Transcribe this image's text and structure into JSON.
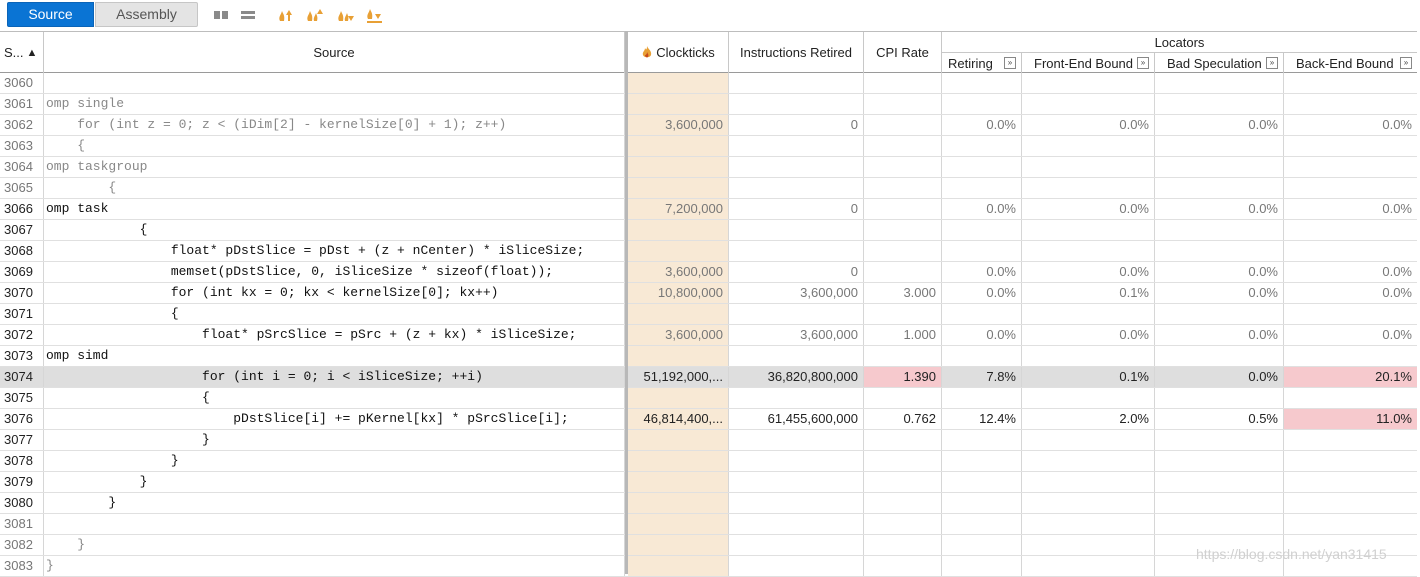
{
  "toolbar": {
    "tab_source": "Source",
    "tab_assembly": "Assembly",
    "icons": [
      "columns-icon",
      "rows-icon",
      "flame-up-icon",
      "flame-up-next-icon",
      "flame-down-icon",
      "flame-down-next-icon"
    ],
    "accent": "#0a74d4",
    "flame_color": "#e8a035"
  },
  "header": {
    "col_line": "S...",
    "col_source": "Source",
    "col_clockticks": "Clockticks",
    "col_instructions": "Instructions Retired",
    "col_cpi": "CPI Rate",
    "group_locators": "Locators",
    "sub_retiring": "Retiring",
    "sub_frontend": "Front-End Bound",
    "sub_badspec": "Bad Speculation",
    "sub_backend": "Back-End Bound",
    "expand_glyph": "»"
  },
  "rows": [
    {
      "line": "3060",
      "src": "",
      "clk": "",
      "ins": "",
      "cpi": "",
      "ret": "",
      "fe": "",
      "bs": "",
      "be": ""
    },
    {
      "line": "3061",
      "src": "omp single",
      "clk": "",
      "ins": "",
      "cpi": "",
      "ret": "",
      "fe": "",
      "bs": "",
      "be": ""
    },
    {
      "line": "3062",
      "src": "    for (int z = 0; z < (iDim[2] - kernelSize[0] + 1); z++)",
      "clk": "3,600,000",
      "ins": "0",
      "cpi": "",
      "ret": "0.0%",
      "fe": "0.0%",
      "bs": "0.0%",
      "be": "0.0%"
    },
    {
      "line": "3063",
      "src": "    {",
      "clk": "",
      "ins": "",
      "cpi": "",
      "ret": "",
      "fe": "",
      "bs": "",
      "be": ""
    },
    {
      "line": "3064",
      "src": "omp taskgroup",
      "clk": "",
      "ins": "",
      "cpi": "",
      "ret": "",
      "fe": "",
      "bs": "",
      "be": ""
    },
    {
      "line": "3065",
      "src": "        {",
      "clk": "",
      "ins": "",
      "cpi": "",
      "ret": "",
      "fe": "",
      "bs": "",
      "be": ""
    },
    {
      "line": "3066",
      "src": "omp task",
      "clk": "7,200,000",
      "ins": "0",
      "cpi": "",
      "ret": "0.0%",
      "fe": "0.0%",
      "bs": "0.0%",
      "be": "0.0%"
    },
    {
      "line": "3067",
      "src": "            {",
      "clk": "",
      "ins": "",
      "cpi": "",
      "ret": "",
      "fe": "",
      "bs": "",
      "be": ""
    },
    {
      "line": "3068",
      "src": "                float* pDstSlice = pDst + (z + nCenter) * iSliceSize;",
      "clk": "",
      "ins": "",
      "cpi": "",
      "ret": "",
      "fe": "",
      "bs": "",
      "be": ""
    },
    {
      "line": "3069",
      "src": "                memset(pDstSlice, 0, iSliceSize * sizeof(float));",
      "clk": "3,600,000",
      "ins": "0",
      "cpi": "",
      "ret": "0.0%",
      "fe": "0.0%",
      "bs": "0.0%",
      "be": "0.0%"
    },
    {
      "line": "3070",
      "src": "                for (int kx = 0; kx < kernelSize[0]; kx++)",
      "clk": "10,800,000",
      "ins": "3,600,000",
      "cpi": "3.000",
      "ret": "0.0%",
      "fe": "0.1%",
      "bs": "0.0%",
      "be": "0.0%"
    },
    {
      "line": "3071",
      "src": "                {",
      "clk": "",
      "ins": "",
      "cpi": "",
      "ret": "",
      "fe": "",
      "bs": "",
      "be": ""
    },
    {
      "line": "3072",
      "src": "                    float* pSrcSlice = pSrc + (z + kx) * iSliceSize;",
      "clk": "3,600,000",
      "ins": "3,600,000",
      "cpi": "1.000",
      "ret": "0.0%",
      "fe": "0.0%",
      "bs": "0.0%",
      "be": "0.0%"
    },
    {
      "line": "3073",
      "src": "omp simd",
      "clk": "",
      "ins": "",
      "cpi": "",
      "ret": "",
      "fe": "",
      "bs": "",
      "be": ""
    },
    {
      "line": "3074",
      "src": "                    for (int i = 0; i < iSliceSize; ++i)",
      "clk": "51,192,000,...",
      "ins": "36,820,800,000",
      "cpi": "1.390",
      "ret": "7.8%",
      "fe": "0.1%",
      "bs": "0.0%",
      "be": "20.1%"
    },
    {
      "line": "3075",
      "src": "                    {",
      "clk": "",
      "ins": "",
      "cpi": "",
      "ret": "",
      "fe": "",
      "bs": "",
      "be": ""
    },
    {
      "line": "3076",
      "src": "                        pDstSlice[i] += pKernel[kx] * pSrcSlice[i];",
      "clk": "46,814,400,...",
      "ins": "61,455,600,000",
      "cpi": "0.762",
      "ret": "12.4%",
      "fe": "2.0%",
      "bs": "0.5%",
      "be": "11.0%"
    },
    {
      "line": "3077",
      "src": "                    }",
      "clk": "",
      "ins": "",
      "cpi": "",
      "ret": "",
      "fe": "",
      "bs": "",
      "be": ""
    },
    {
      "line": "3078",
      "src": "                }",
      "clk": "",
      "ins": "",
      "cpi": "",
      "ret": "",
      "fe": "",
      "bs": "",
      "be": ""
    },
    {
      "line": "3079",
      "src": "            }",
      "clk": "",
      "ins": "",
      "cpi": "",
      "ret": "",
      "fe": "",
      "bs": "",
      "be": ""
    },
    {
      "line": "3080",
      "src": "        }",
      "clk": "",
      "ins": "",
      "cpi": "",
      "ret": "",
      "fe": "",
      "bs": "",
      "be": ""
    },
    {
      "line": "3081",
      "src": "",
      "clk": "",
      "ins": "",
      "cpi": "",
      "ret": "",
      "fe": "",
      "bs": "",
      "be": ""
    },
    {
      "line": "3082",
      "src": "    }",
      "clk": "",
      "ins": "",
      "cpi": "",
      "ret": "",
      "fe": "",
      "bs": "",
      "be": ""
    },
    {
      "line": "3083",
      "src": "}",
      "clk": "",
      "ins": "",
      "cpi": "",
      "ret": "",
      "fe": "",
      "bs": "",
      "be": ""
    }
  ],
  "row_flags": {
    "executed": [
      "3066",
      "3067",
      "3068",
      "3069",
      "3070",
      "3071",
      "3072",
      "3073",
      "3074",
      "3075",
      "3076",
      "3077",
      "3078",
      "3079",
      "3080"
    ],
    "hot": [
      "3074",
      "3076"
    ],
    "selected": "3074",
    "pink_cpi": [
      "3074"
    ],
    "pink_backend": [
      "3074",
      "3076"
    ]
  },
  "colors": {
    "clockticks_bg": "#f8e9d5",
    "highlight_pink": "#f6c9cd",
    "selected_row": "#dedede"
  },
  "watermark": "https://blog.csdn.net/yan31415"
}
